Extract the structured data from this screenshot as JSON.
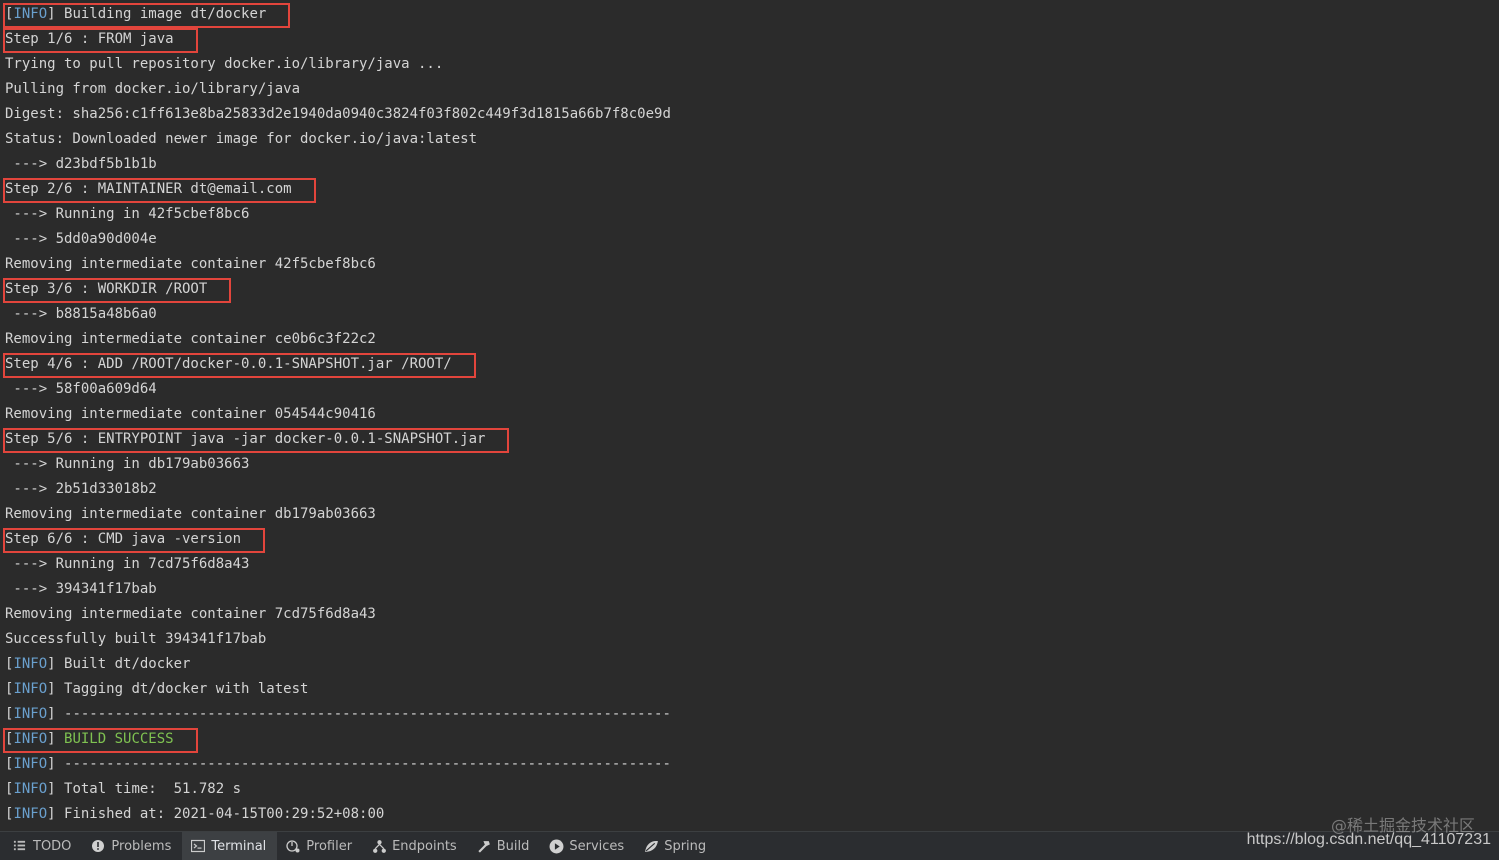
{
  "terminal": {
    "lines": [
      {
        "kind": "info",
        "text": " Building image dt/docker"
      },
      {
        "kind": "plain",
        "text": "Step 1/6 : FROM java"
      },
      {
        "kind": "plain",
        "text": "Trying to pull repository docker.io/library/java ..."
      },
      {
        "kind": "plain",
        "text": "Pulling from docker.io/library/java"
      },
      {
        "kind": "plain",
        "text": "Digest: sha256:c1ff613e8ba25833d2e1940da0940c3824f03f802c449f3d1815a66b7f8c0e9d"
      },
      {
        "kind": "plain",
        "text": "Status: Downloaded newer image for docker.io/java:latest"
      },
      {
        "kind": "plain",
        "text": " ---> d23bdf5b1b1b"
      },
      {
        "kind": "plain",
        "text": "Step 2/6 : MAINTAINER dt@email.com"
      },
      {
        "kind": "plain",
        "text": " ---> Running in 42f5cbef8bc6"
      },
      {
        "kind": "plain",
        "text": " ---> 5dd0a90d004e"
      },
      {
        "kind": "plain",
        "text": "Removing intermediate container 42f5cbef8bc6"
      },
      {
        "kind": "plain",
        "text": "Step 3/6 : WORKDIR /ROOT"
      },
      {
        "kind": "plain",
        "text": " ---> b8815a48b6a0"
      },
      {
        "kind": "plain",
        "text": "Removing intermediate container ce0b6c3f22c2"
      },
      {
        "kind": "plain",
        "text": "Step 4/6 : ADD /ROOT/docker-0.0.1-SNAPSHOT.jar /ROOT/"
      },
      {
        "kind": "plain",
        "text": " ---> 58f00a609d64"
      },
      {
        "kind": "plain",
        "text": "Removing intermediate container 054544c90416"
      },
      {
        "kind": "plain",
        "text": "Step 5/6 : ENTRYPOINT java -jar docker-0.0.1-SNAPSHOT.jar"
      },
      {
        "kind": "plain",
        "text": " ---> Running in db179ab03663"
      },
      {
        "kind": "plain",
        "text": " ---> 2b51d33018b2"
      },
      {
        "kind": "plain",
        "text": "Removing intermediate container db179ab03663"
      },
      {
        "kind": "plain",
        "text": "Step 6/6 : CMD java -version"
      },
      {
        "kind": "plain",
        "text": " ---> Running in 7cd75f6d8a43"
      },
      {
        "kind": "plain",
        "text": " ---> 394341f17bab"
      },
      {
        "kind": "plain",
        "text": "Removing intermediate container 7cd75f6d8a43"
      },
      {
        "kind": "plain",
        "text": "Successfully built 394341f17bab"
      },
      {
        "kind": "info",
        "text": " Built dt/docker"
      },
      {
        "kind": "info",
        "text": " Tagging dt/docker with latest"
      },
      {
        "kind": "info",
        "text": " ------------------------------------------------------------------------"
      },
      {
        "kind": "info-success",
        "text": " BUILD SUCCESS"
      },
      {
        "kind": "info",
        "text": " ------------------------------------------------------------------------"
      },
      {
        "kind": "info",
        "text": " Total time:  51.782 s"
      },
      {
        "kind": "info",
        "text": " Finished at: 2021-04-15T00:29:52+08:00"
      }
    ],
    "info_tag": "INFO",
    "highlight_rows": [
      0,
      1,
      7,
      11,
      14,
      17,
      21,
      29
    ],
    "colors": {
      "info_tag": "#6aa0ce",
      "success": "#7fc251",
      "highlight_border": "#e2453c",
      "background": "#2b2b2b"
    }
  },
  "toolbar": {
    "tabs": [
      {
        "label": "TODO",
        "icon": "list-icon",
        "active": false
      },
      {
        "label": "Problems",
        "icon": "warning-circle-icon",
        "active": false
      },
      {
        "label": "Terminal",
        "icon": "terminal-icon",
        "active": true
      },
      {
        "label": "Profiler",
        "icon": "profiler-icon",
        "active": false
      },
      {
        "label": "Endpoints",
        "icon": "endpoints-icon",
        "active": false
      },
      {
        "label": "Build",
        "icon": "hammer-icon",
        "active": false
      },
      {
        "label": "Services",
        "icon": "play-circle-icon",
        "active": false
      },
      {
        "label": "Spring",
        "icon": "spring-leaf-icon",
        "active": false
      }
    ]
  },
  "watermark": {
    "text": "@稀土掘金技术社区"
  },
  "source_url": "https://blog.csdn.net/qq_41107231"
}
